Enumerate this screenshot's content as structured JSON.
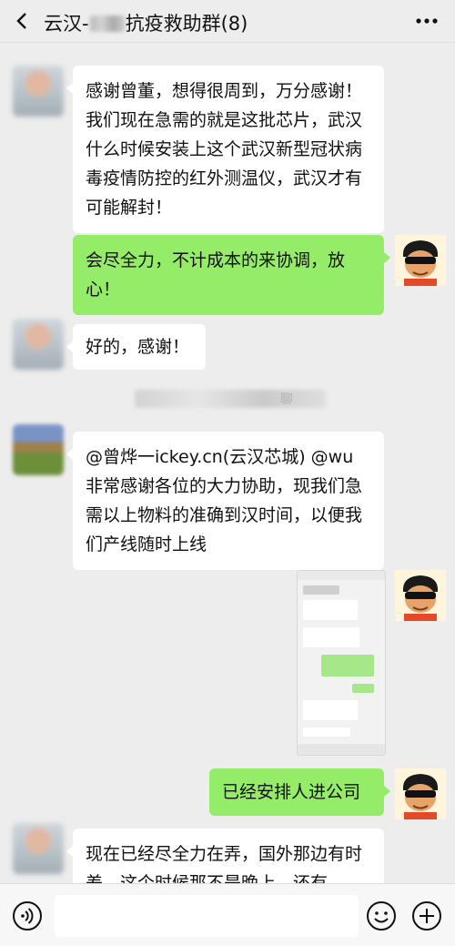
{
  "header": {
    "title_prefix": "云汉-",
    "title_suffix": "抗疫救助群(8)",
    "back_icon": "chevron-left-icon",
    "more_icon": "more-horizontal-icon"
  },
  "messages": [
    {
      "side": "left",
      "text": "感谢曾董，想得很周到，万分感谢！我们现在急需的就是这批芯片，武汉什么时候安装上这个武汉新型冠状病毒疫情防控的红外测温仪，武汉才有可能解封！"
    },
    {
      "side": "right",
      "text": "会尽全力，不计成本的来协调，放心！"
    },
    {
      "side": "left",
      "text": "好的，感谢！"
    },
    {
      "side": "system",
      "text": "聊"
    },
    {
      "side": "left",
      "text": "@曾烨一ickey.cn(云汉芯城) @wu 非常感谢各位的大力协助，现我们急需以上物料的准确到汉时间，以便我们产线随时上线"
    },
    {
      "side": "right",
      "type": "image",
      "text": ""
    },
    {
      "side": "right",
      "text": "已经安排人进公司"
    },
    {
      "side": "left",
      "text": "现在已经尽全力在弄，国外那边有时差，这个时候那不是晚上，还有"
    }
  ],
  "input_bar": {
    "voice_icon": "voice-icon",
    "emoji_icon": "emoji-icon",
    "plus_icon": "plus-icon",
    "input_value": ""
  },
  "colors": {
    "background": "#ededed",
    "incoming_bubble": "#ffffff",
    "outgoing_bubble": "#95ec69"
  }
}
